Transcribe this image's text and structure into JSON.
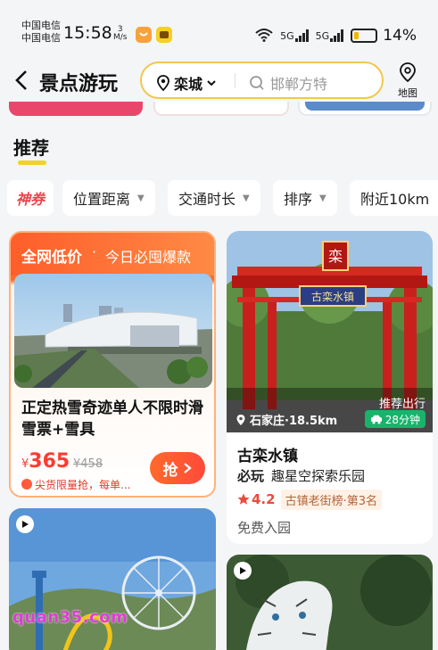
{
  "status_bar": {
    "carrier_1": "中国电信",
    "carrier_2": "中国电信",
    "time": "15:58",
    "net_speed_value": "3",
    "net_speed_unit": "M/s",
    "signal_1": "5G",
    "signal_2": "5G",
    "battery_percent": "14%"
  },
  "nav": {
    "back_icon": "chevron-left-icon",
    "title": "景点游玩",
    "city": "栾城",
    "search_placeholder": "邯郸方特",
    "map_label": "地图"
  },
  "section": {
    "tab_label": "推荐"
  },
  "filters": [
    {
      "label": "神券"
    },
    {
      "label": "位置距离"
    },
    {
      "label": "交通时长"
    },
    {
      "label": "排序"
    },
    {
      "label": "附近10km"
    }
  ],
  "deal_card": {
    "header_main": "全网低价",
    "header_sep": "·",
    "header_sub": "今日必囤爆款",
    "name": "正定热雪奇迹单人不限时滑雪票+雪具",
    "currency": "¥",
    "price": "365",
    "original_price": "¥458",
    "note": "尖货限量抢，每单...",
    "grab_label": "抢"
  },
  "attraction_card": {
    "location": "石家庄·18.5km",
    "trip_label": "推荐出行",
    "trip_time": "28分钟",
    "name": "古栾水镇",
    "must_label": "必玩",
    "must_text": "趣星空探索乐园",
    "score": "4.2",
    "rank": "古镇老街榜·第3名",
    "price_text": "免费入园"
  },
  "gate_sign": "古栾水镇",
  "watermark": "quan35.com",
  "colors": {
    "accent_yellow": "#f5cf2d",
    "deal_orange": "#ff6b2e",
    "price_red": "#ff3b30",
    "trip_green": "#19b36b"
  }
}
